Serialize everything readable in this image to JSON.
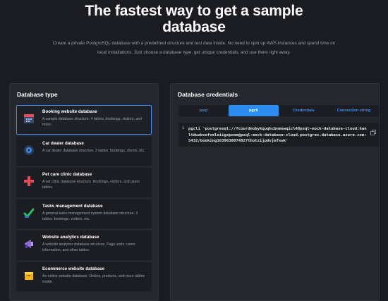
{
  "hero": {
    "title_line1": "The fastest way to get a sample",
    "title_line2": "database",
    "subtitle": "Create a private PostgreSQL database with a predefined structure and test data inside. No need to spin up AWS instances and spend time on local installations. Just choose a database type, get unique credentials, and use them right away."
  },
  "left_panel": {
    "title": "Database type",
    "items": [
      {
        "name": "Booking website database",
        "desc": "A sample database structure. 4 tables: bookings, visitors, and more.",
        "icon": "calendar-icon"
      },
      {
        "name": "Car dealer database",
        "desc": "A car dealer database structure. 3 tables: bookings, clients, etc.",
        "icon": "wheel-icon"
      },
      {
        "name": "Pet care clinic database",
        "desc": "A vet clinic database structure. Bookings, visitors, and users tables.",
        "icon": "medical-cross-icon"
      },
      {
        "name": "Tasks management database",
        "desc": "A general tasks management system database structure. 3 tables, bookings, visitors, etc.",
        "icon": "checkmark-icon"
      },
      {
        "name": "Website analytics database",
        "desc": "A website analytics database structure. Page visits, users information, and other tables.",
        "icon": "megaphone-icon"
      },
      {
        "name": "Ecommerce website database",
        "desc": "An online website database. Orders, products, and more tables inside.",
        "icon": "box-icon"
      }
    ]
  },
  "right_panel": {
    "title": "Database credentials",
    "tabs": [
      "psql",
      "pgcli",
      "Credentials",
      "Connection string"
    ],
    "active_tab": "pgcli",
    "code_prompt": "$",
    "code": "pgcli 'postgresql://fcourdnobykquqhcbnmewqic%40psql-mock-database-cloud:hanltdwzbvefvmloiigxpoom@psql-mock-database-cloud.postgres.database.azure.com:5432/booking1639638074827thotzijpdvjmfswk'"
  },
  "colors": {
    "background": "#1a1c21",
    "panel": "#24272d",
    "card": "#1b1d22",
    "accent": "#2d8cf0"
  }
}
